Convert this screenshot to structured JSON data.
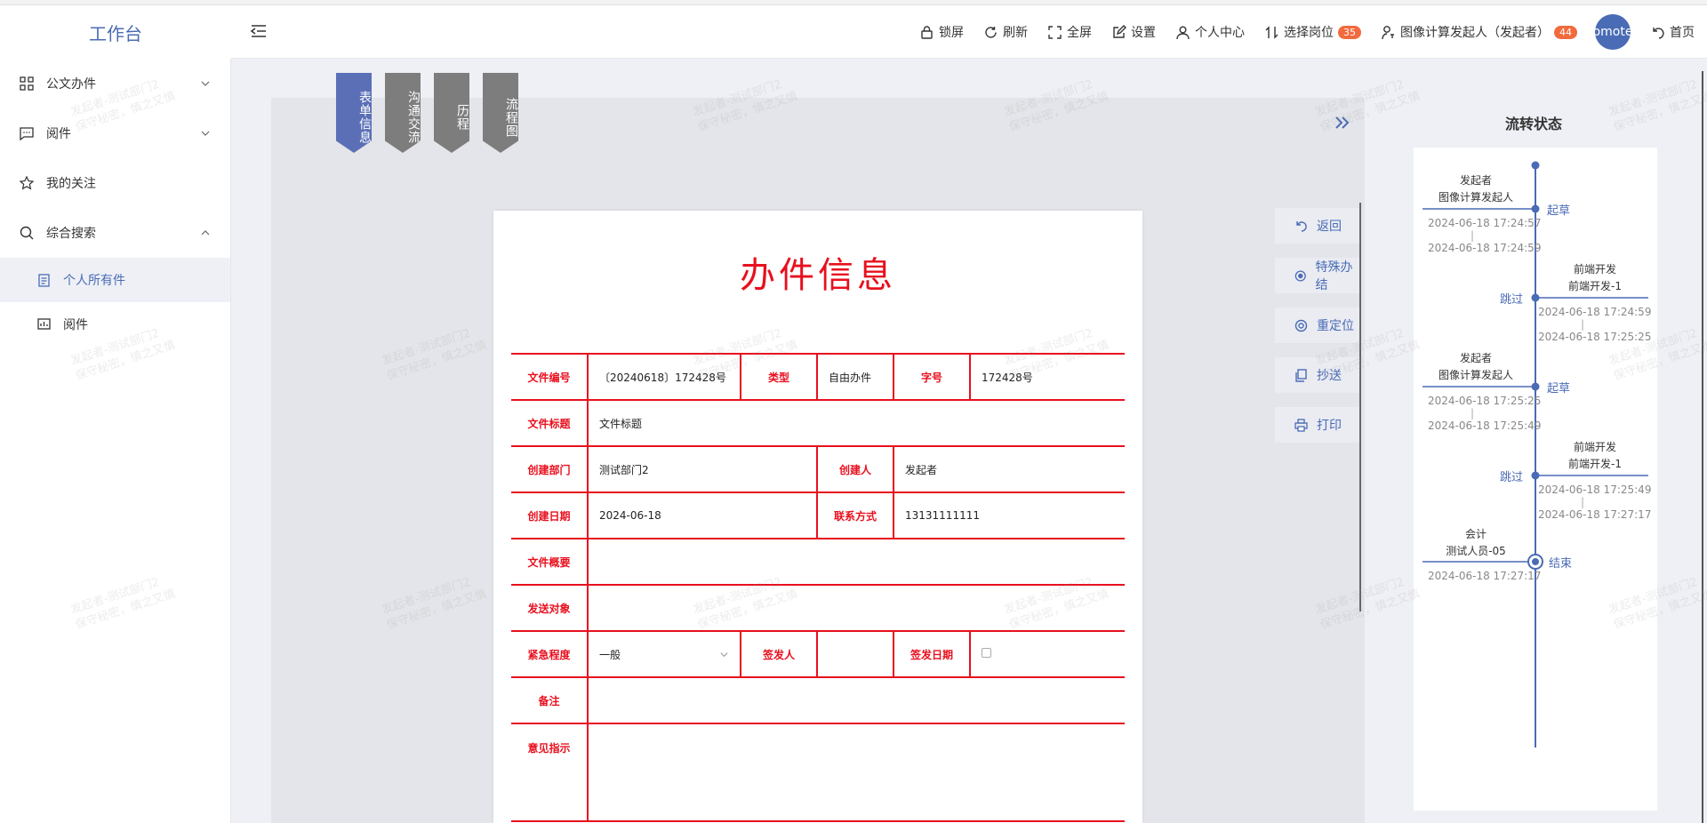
{
  "app": {
    "logo": "工作台"
  },
  "topbar": {
    "actions": [
      {
        "label": "锁屏",
        "icon": "lock-icon"
      },
      {
        "label": "刷新",
        "icon": "refresh-icon"
      },
      {
        "label": "全屏",
        "icon": "fullscreen-icon"
      },
      {
        "label": "设置",
        "icon": "edit-icon"
      },
      {
        "label": "个人中心",
        "icon": "user-icon"
      },
      {
        "label": "选择岗位",
        "icon": "switch-icon",
        "badge": "35"
      },
      {
        "label": "图像计算发起人（发起者）",
        "icon": "user-key-icon",
        "badge": "44"
      }
    ],
    "avatar_text": "omote",
    "home_label": "首页"
  },
  "sidebar": {
    "items": [
      {
        "label": "公文办件",
        "icon": "grid-icon",
        "chevron": "down"
      },
      {
        "label": "阅件",
        "icon": "message-icon",
        "chevron": "down"
      },
      {
        "label": "我的关注",
        "icon": "star-icon"
      },
      {
        "label": "综合搜索",
        "icon": "search-icon",
        "chevron": "up"
      }
    ],
    "sub_items": [
      {
        "label": "个人所有件",
        "icon": "document-icon",
        "active": true
      },
      {
        "label": "阅件",
        "icon": "chart-box-icon"
      }
    ]
  },
  "tabs": [
    {
      "label": "表单信息",
      "active": true
    },
    {
      "label": "沟通交流"
    },
    {
      "label": "历程"
    },
    {
      "label": "流程图"
    }
  ],
  "form": {
    "title": "办件信息",
    "labels": {
      "file_no": "文件编号",
      "type": "类型",
      "word_no": "字号",
      "file_title": "文件标题",
      "dept": "创建部门",
      "creator": "创建人",
      "create_date": "创建日期",
      "contact": "联系方式",
      "summary": "文件概要",
      "send_to": "发送对象",
      "urgency": "紧急程度",
      "signer": "签发人",
      "sign_date": "签发日期",
      "remark": "备注",
      "opinion": "意见指示"
    },
    "values": {
      "file_no": "〔20240618〕172428号",
      "type": "自由办件",
      "word_no": "172428号",
      "file_title": "文件标题",
      "dept": "测试部门2",
      "creator": "发起者",
      "create_date": "2024-06-18",
      "contact": "13131111111",
      "urgency": "一般"
    }
  },
  "actions": [
    {
      "label": "返回",
      "icon": "undo-icon"
    },
    {
      "label": "特殊办结",
      "icon": "radio-icon"
    },
    {
      "label": "重定位",
      "icon": "target-icon"
    },
    {
      "label": "抄送",
      "icon": "copy-icon"
    },
    {
      "label": "打印",
      "icon": "print-icon"
    }
  ],
  "flow": {
    "title": "流转状态",
    "steps": [
      {
        "side": "left",
        "name1": "发起者",
        "name2": "图像计算发起人",
        "action": "起草",
        "t1": "2024-06-18 17:24:57",
        "t2": "2024-06-18 17:24:59"
      },
      {
        "side": "right",
        "name1": "前端开发",
        "name2": "前端开发-1",
        "action": "跳过",
        "t1": "2024-06-18 17:24:59",
        "t2": "2024-06-18 17:25:25"
      },
      {
        "side": "left",
        "name1": "发起者",
        "name2": "图像计算发起人",
        "action": "起草",
        "t1": "2024-06-18 17:25:25",
        "t2": "2024-06-18 17:25:49"
      },
      {
        "side": "right",
        "name1": "前端开发",
        "name2": "前端开发-1",
        "action": "跳过",
        "t1": "2024-06-18 17:25:49",
        "t2": "2024-06-18 17:27:17"
      },
      {
        "side": "left",
        "name1": "会计",
        "name2": "测试人员-05",
        "action": "结束",
        "t1": "2024-06-18 17:27:17",
        "t2": ""
      }
    ]
  },
  "watermark": {
    "line1": "发起者-测试部门2",
    "line2": "保守秘密，慎之又慎"
  }
}
